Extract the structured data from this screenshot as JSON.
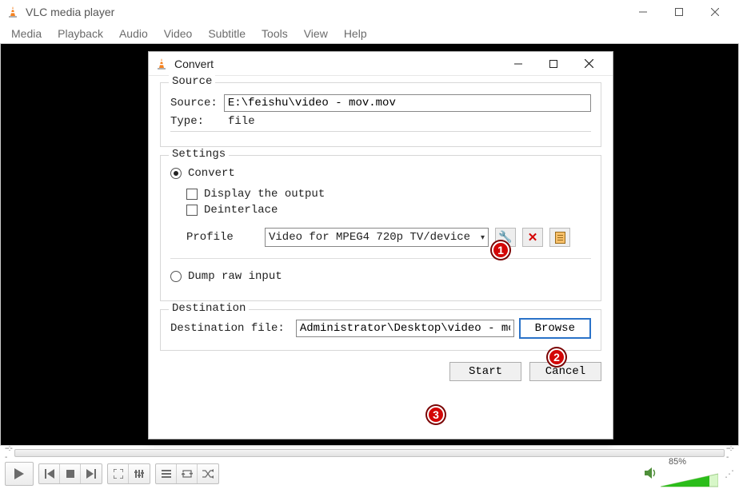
{
  "main_window": {
    "title": "VLC media player",
    "menu": [
      "Media",
      "Playback",
      "Audio",
      "Video",
      "Subtitle",
      "Tools",
      "View",
      "Help"
    ],
    "volume_percent": "85%"
  },
  "dialog": {
    "title": "Convert",
    "source": {
      "legend": "Source",
      "source_label": "Source:",
      "source_value": "E:\\feishu\\video - mov.mov",
      "type_label": "Type:",
      "type_value": "file"
    },
    "settings": {
      "legend": "Settings",
      "convert_label": "Convert",
      "display_output_label": "Display the output",
      "deinterlace_label": "Deinterlace",
      "profile_label": "Profile",
      "profile_value": "Video for MPEG4 720p TV/device",
      "dump_raw_label": "Dump raw input"
    },
    "destination": {
      "legend": "Destination",
      "dest_file_label": "Destination file:",
      "dest_file_value": "Administrator\\Desktop\\video - mov.mov",
      "browse_label": "Browse"
    },
    "buttons": {
      "start": "Start",
      "cancel": "Cancel"
    }
  },
  "annotations": {
    "a1": "1",
    "a2": "2",
    "a3": "3"
  }
}
